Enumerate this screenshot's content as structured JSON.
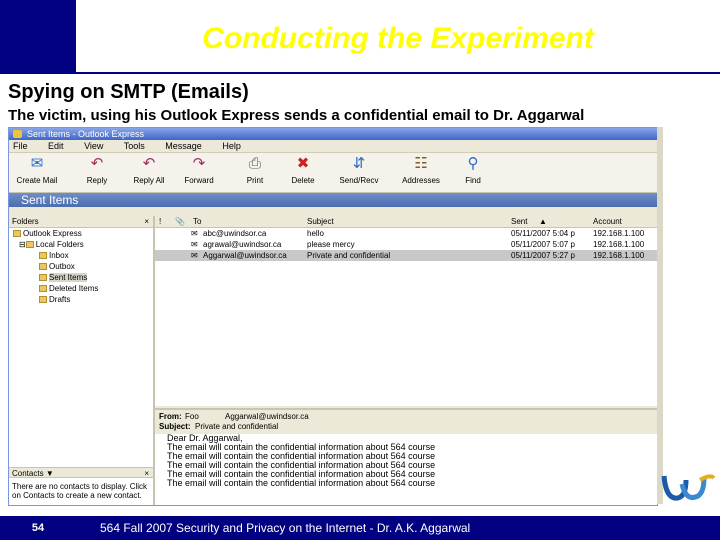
{
  "slide": {
    "title": "Conducting the Experiment",
    "heading": "Spying on SMTP (Emails)",
    "subheading": "The victim, using his Outlook Express sends a confidential email to Dr. Aggarwal",
    "page_number": "54",
    "footer": "564 Fall 2007 Security and Privacy on the Internet - Dr. A.K. Aggarwal"
  },
  "window": {
    "title": "Sent Items - Outlook Express",
    "menu": [
      "File",
      "Edit",
      "View",
      "Tools",
      "Message",
      "Help"
    ],
    "toolbar": [
      {
        "label": "Create Mail",
        "icon": "create-mail-icon"
      },
      {
        "label": "Reply",
        "icon": "reply-icon"
      },
      {
        "label": "Reply All",
        "icon": "reply-all-icon"
      },
      {
        "label": "Forward",
        "icon": "forward-icon"
      },
      {
        "label": "Print",
        "icon": "print-icon"
      },
      {
        "label": "Delete",
        "icon": "delete-icon"
      },
      {
        "label": "Send/Recv",
        "icon": "send-receive-icon"
      },
      {
        "label": "Addresses",
        "icon": "addresses-icon"
      },
      {
        "label": "Find",
        "icon": "find-icon"
      }
    ],
    "folder_title": "Sent Items",
    "folders_label": "Folders",
    "folders": [
      {
        "label": "Outlook Express",
        "level": 0
      },
      {
        "label": "Local Folders",
        "level": 1
      },
      {
        "label": "Inbox",
        "level": 2
      },
      {
        "label": "Outbox",
        "level": 2
      },
      {
        "label": "Sent Items",
        "level": 2
      },
      {
        "label": "Deleted Items",
        "level": 2
      },
      {
        "label": "Drafts",
        "level": 2
      }
    ],
    "columns": {
      "to": "To",
      "subject": "Subject",
      "sent": "Sent",
      "account": "Account"
    },
    "messages": [
      {
        "to": "abc@uwindsor.ca",
        "subject": "hello",
        "sent": "05/11/2007 5:04 p",
        "account": "192.168.1.100"
      },
      {
        "to": "agrawal@uwindsor.ca",
        "subject": "please mercy",
        "sent": "05/11/2007 5:07 p",
        "account": "192.168.1.100"
      },
      {
        "to": "Aggarwal@uwindsor.ca",
        "subject": "Private and confidential",
        "sent": "05/11/2007 5:27 p",
        "account": "192.168.1.100"
      }
    ],
    "preview": {
      "from_label": "From:",
      "from_value": "Foo",
      "to_value": "Aggarwal@uwindsor.ca",
      "subject_label": "Subject:",
      "subject_value": "Private and confidential",
      "body": [
        "Dear Dr. Aggarwal,",
        "The email will contain the confidential information about 564 course",
        "The email will contain the confidential information about 564 course",
        "The email will contain the confidential information about 564 course",
        "The email will contain the confidential information about 564 course",
        "The email will contain the confidential information about 564 course"
      ]
    },
    "contacts_label": "Contacts",
    "contacts_message": "There are no contacts to display. Click on Contacts to create a new contact."
  }
}
